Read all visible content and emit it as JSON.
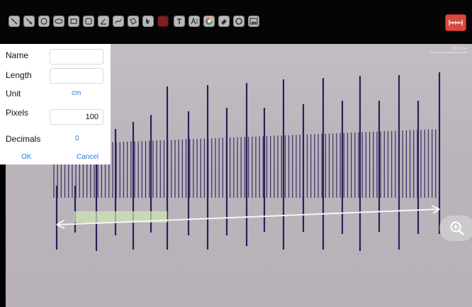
{
  "toolbar": {
    "tools": [
      {
        "icon": "line-icon"
      },
      {
        "icon": "arrow-line-icon"
      },
      {
        "icon": "circle-icon"
      },
      {
        "icon": "ellipse-icon"
      },
      {
        "icon": "rectangle-icon"
      },
      {
        "icon": "rounded-rect-icon"
      },
      {
        "icon": "angle-icon"
      },
      {
        "icon": "curve-icon"
      },
      {
        "icon": "polygon-icon"
      },
      {
        "icon": "pointer-icon"
      },
      {
        "icon": "color-swatch-icon",
        "color": "#7a2020"
      },
      {
        "icon": "text-icon"
      },
      {
        "icon": "text-style-icon"
      },
      {
        "icon": "color-wheel-icon"
      },
      {
        "icon": "eraser-icon"
      },
      {
        "icon": "circle-outline-icon"
      },
      {
        "icon": "image-icon"
      }
    ],
    "calibrate_icon": "ruler-calibration-icon",
    "accent": "#d94a3e"
  },
  "viewer": {
    "scale_label": "10.00 cm",
    "zoom_icon": "zoom-in-icon"
  },
  "calibration_panel": {
    "name_label": "Name",
    "name_value": "",
    "length_label": "Length",
    "length_value": "",
    "unit_label": "Unit",
    "unit_value": "cm",
    "pixels_label": "Pixels",
    "pixels_value": "100",
    "decimals_label": "Decimals",
    "decimals_value": "0",
    "ok_label": "OK",
    "cancel_label": "Cancel",
    "link_color": "#2a7bd4"
  }
}
